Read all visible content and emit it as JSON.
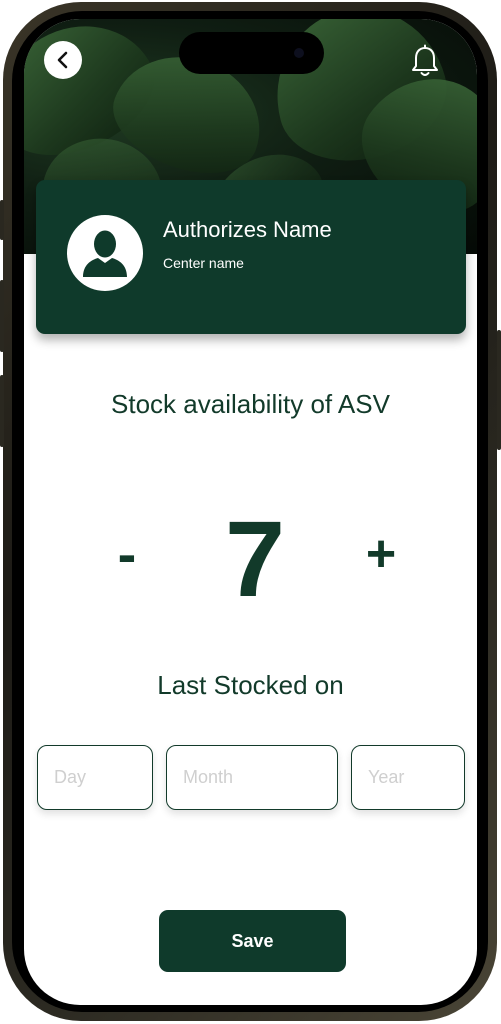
{
  "header": {
    "back_icon": "chevron-left-icon",
    "notification_icon": "bell-icon"
  },
  "profile": {
    "name": "Authorizes Name",
    "center": "Center name",
    "avatar_icon": "user-silhouette-icon"
  },
  "stock": {
    "title": "Stock availability of ASV",
    "decrement_label": "-",
    "count": "7",
    "increment_label": "+"
  },
  "last_stocked": {
    "title": "Last Stocked on",
    "day_placeholder": "Day",
    "month_placeholder": "Month",
    "year_placeholder": "Year"
  },
  "actions": {
    "save_label": "Save"
  },
  "colors": {
    "brand": "#0f3a2b",
    "text": "#123a2a",
    "placeholder": "#cfcfcf"
  }
}
